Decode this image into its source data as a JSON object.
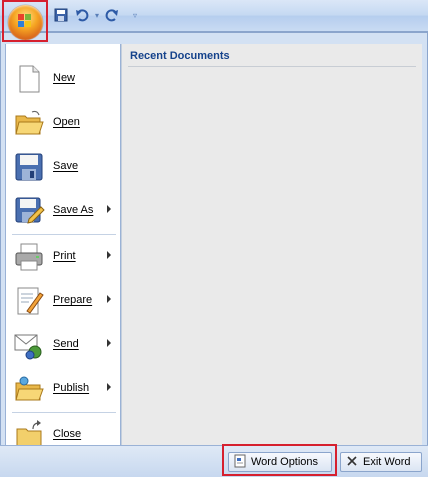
{
  "qat": {
    "save_icon": "save-icon",
    "undo_icon": "undo-icon",
    "redo_icon": "redo-icon",
    "customize_icon": "customize-dropdown-icon"
  },
  "menu": {
    "commands": [
      {
        "key": "new",
        "label": "New",
        "icon": "new-document-icon",
        "submenu": false
      },
      {
        "key": "open",
        "label": "Open",
        "icon": "open-folder-icon",
        "submenu": false
      },
      {
        "key": "save",
        "label": "Save",
        "icon": "floppy-disk-icon",
        "submenu": false
      },
      {
        "key": "save-as",
        "label": "Save As",
        "icon": "save-as-icon",
        "submenu": true
      },
      {
        "key": "print",
        "label": "Print",
        "icon": "printer-icon",
        "submenu": true
      },
      {
        "key": "prepare",
        "label": "Prepare",
        "icon": "prepare-icon",
        "submenu": true
      },
      {
        "key": "send",
        "label": "Send",
        "icon": "send-icon",
        "submenu": true
      },
      {
        "key": "publish",
        "label": "Publish",
        "icon": "publish-icon",
        "submenu": true
      },
      {
        "key": "close",
        "label": "Close",
        "icon": "close-folder-icon",
        "submenu": false
      }
    ],
    "recent_title": "Recent Documents"
  },
  "footer": {
    "word_options_label": "Word Options",
    "exit_word_label": "Exit Word"
  },
  "colors": {
    "highlight_frame": "#d6202f",
    "title_text": "#15428b"
  }
}
